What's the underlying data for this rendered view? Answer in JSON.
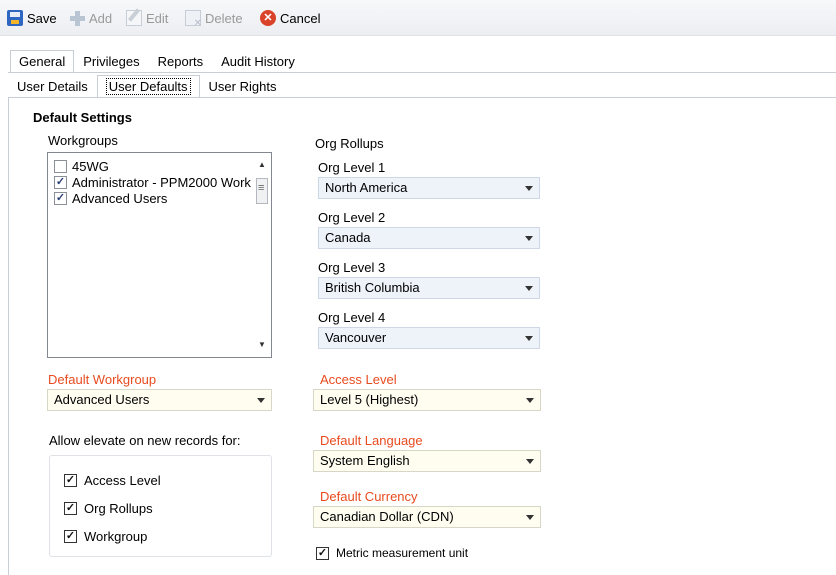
{
  "toolbar": {
    "save": "Save",
    "add": "Add",
    "edit": "Edit",
    "delete": "Delete",
    "cancel": "Cancel"
  },
  "tabs": [
    "General",
    "Privileges",
    "Reports",
    "Audit History"
  ],
  "subtabs": [
    "User Details",
    "User Defaults",
    "User Rights"
  ],
  "section_title": "Default Settings",
  "workgroups": {
    "label": "Workgroups",
    "items": [
      {
        "label": "45WG",
        "checked": false
      },
      {
        "label": "Administrator - PPM2000 Work",
        "checked": true
      },
      {
        "label": "Advanced Users",
        "checked": true
      }
    ]
  },
  "default_workgroup": {
    "label": "Default Workgroup",
    "value": "Advanced Users"
  },
  "elevate": {
    "label": "Allow elevate on new records for:",
    "items": [
      {
        "label": "Access Level",
        "checked": true
      },
      {
        "label": "Org Rollups",
        "checked": true
      },
      {
        "label": "Workgroup",
        "checked": true
      }
    ]
  },
  "org_rollups": {
    "label": "Org Rollups",
    "levels": [
      {
        "label": "Org Level 1",
        "value": "North America"
      },
      {
        "label": "Org Level 2",
        "value": "Canada"
      },
      {
        "label": "Org Level 3",
        "value": "British Columbia"
      },
      {
        "label": "Org Level 4",
        "value": "Vancouver"
      }
    ]
  },
  "access_level": {
    "label": "Access Level",
    "value": "Level 5 (Highest)"
  },
  "default_language": {
    "label": "Default Language",
    "value": "System English"
  },
  "default_currency": {
    "label": "Default Currency",
    "value": "Canadian Dollar (CDN)"
  },
  "metric": {
    "label": "Metric measurement unit",
    "checked": true
  },
  "colors": {
    "required_label": "#e84b1f",
    "accent": "#2f66c2"
  }
}
